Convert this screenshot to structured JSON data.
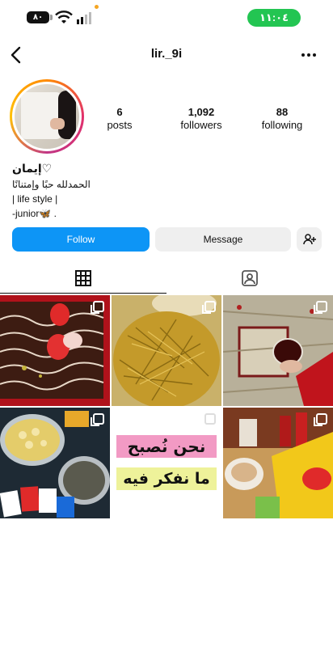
{
  "status_bar": {
    "battery": "٨٠",
    "time": "١١:٠٤"
  },
  "header": {
    "username": "lir._9i"
  },
  "profile": {
    "stats": [
      {
        "value": "6",
        "label": "posts"
      },
      {
        "value": "1,092",
        "label": "followers"
      },
      {
        "value": "88",
        "label": "following"
      }
    ],
    "name": "إيمان♡",
    "bio": [
      "الحمدلله حبًا وإمتنانًا",
      "| life style |",
      "-junior🦋 ."
    ]
  },
  "actions": {
    "follow": "Follow",
    "message": "Message"
  },
  "posts": {
    "art_line1": "نحن نُصبح",
    "art_line2": "ما نفكر فيه"
  },
  "colors": {
    "accent": "#0d95f6",
    "status_green": "#23c552"
  }
}
